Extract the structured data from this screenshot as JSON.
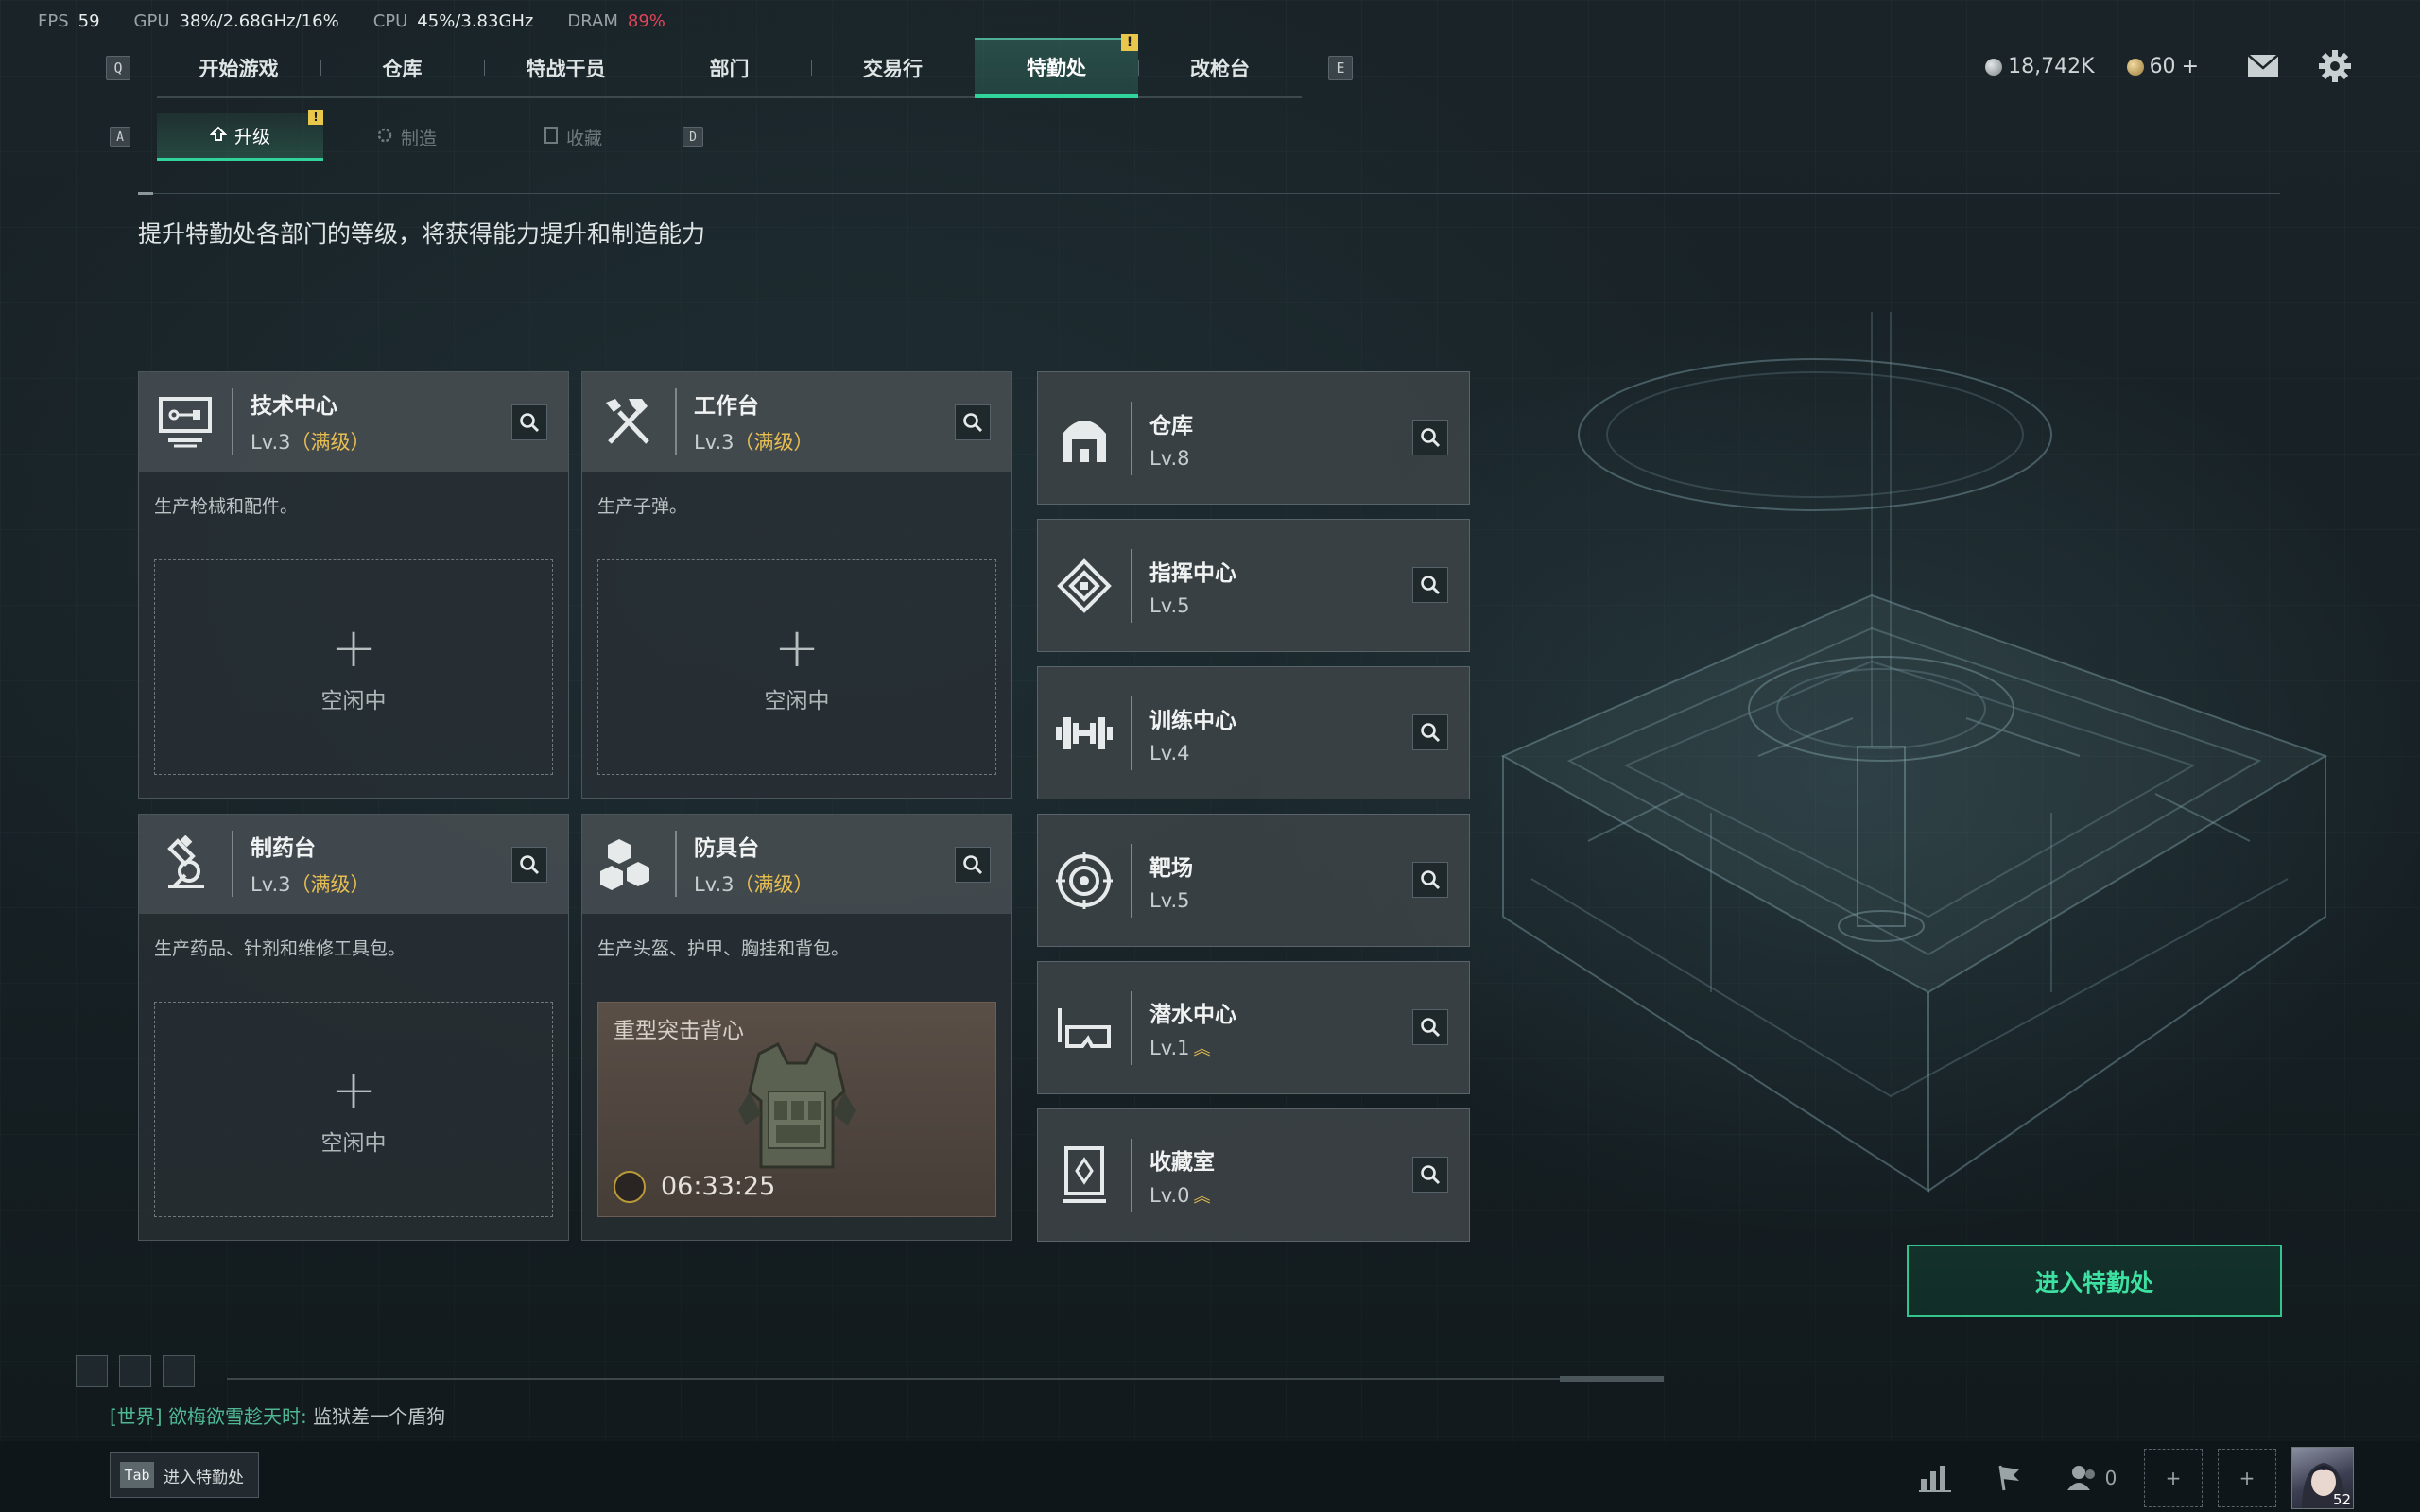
{
  "perf": {
    "fps_label": "FPS",
    "fps": "59",
    "gpu_label": "GPU",
    "gpu": "38%/2.68GHz/16%",
    "cpu_label": "CPU",
    "cpu": "45%/3.83GHz",
    "dram_label": "DRAM",
    "dram": "89%"
  },
  "nav": {
    "prev_key": "Q",
    "next_key": "E",
    "items": [
      {
        "label": "开始游戏"
      },
      {
        "label": "仓库"
      },
      {
        "label": "特战干员"
      },
      {
        "label": "部门"
      },
      {
        "label": "交易行"
      },
      {
        "label": "特勤处",
        "active": true,
        "badge": "!"
      },
      {
        "label": "改枪台"
      }
    ]
  },
  "currency": {
    "silver": "18,742K",
    "gold": "60",
    "gold_add": "+"
  },
  "subtabs": {
    "prev_key": "A",
    "next_key": "D",
    "items": [
      {
        "label": "升级",
        "active": true,
        "badge": "!"
      },
      {
        "label": "制造"
      },
      {
        "label": "收藏"
      }
    ]
  },
  "description": "提升特勤处各部门的等级，将获得能力提升和制造能力",
  "workshops": [
    {
      "title": "技术中心",
      "level": "Lv.3",
      "max": "（满级）",
      "desc": "生产枪械和配件。",
      "slot": "空闲中",
      "icon": "tech-center-icon"
    },
    {
      "title": "工作台",
      "level": "Lv.3",
      "max": "（满级）",
      "desc": "生产子弹。",
      "slot": "空闲中",
      "icon": "workbench-icon"
    },
    {
      "title": "制药台",
      "level": "Lv.3",
      "max": "（满级）",
      "desc": "生产药品、针剂和维修工具包。",
      "slot": "空闲中",
      "icon": "pharmacy-icon"
    },
    {
      "title": "防具台",
      "level": "Lv.3",
      "max": "（满级）",
      "desc": "生产头盔、护甲、胸挂和背包。",
      "craft_name": "重型突击背心",
      "craft_time": "06:33:25",
      "icon": "armor-bench-icon"
    }
  ],
  "facilities": [
    {
      "title": "仓库",
      "level": "Lv.8",
      "icon": "warehouse-icon"
    },
    {
      "title": "指挥中心",
      "level": "Lv.5",
      "icon": "command-center-icon"
    },
    {
      "title": "训练中心",
      "level": "Lv.4",
      "icon": "training-center-icon"
    },
    {
      "title": "靶场",
      "level": "Lv.5",
      "icon": "shooting-range-icon"
    },
    {
      "title": "潜水中心",
      "level": "Lv.1",
      "upgradable": true,
      "icon": "diving-center-icon"
    },
    {
      "title": "收藏室",
      "level": "Lv.0",
      "upgradable": true,
      "icon": "collection-room-icon"
    }
  ],
  "enter_button": "进入特勤处",
  "chat": {
    "channel": "[世界]",
    "user": "欲梅欲雪趁天时:",
    "message": "监狱差一个盾狗"
  },
  "bottom": {
    "tab_key": "Tab",
    "tab_label": "进入特勤处",
    "friends_count": "0",
    "avatar_level": "52"
  },
  "colors": {
    "accent": "#30d39a",
    "max_level": "#e7be52",
    "badge": "#e8c74a",
    "dram_warn": "#e0455a"
  }
}
